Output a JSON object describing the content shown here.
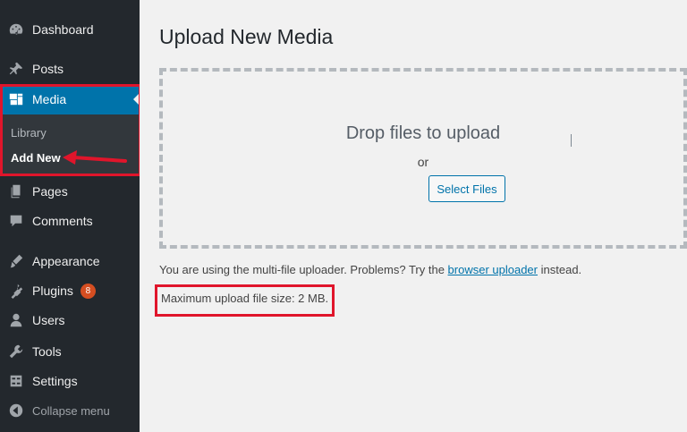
{
  "sidebar": {
    "items": [
      {
        "label": "Dashboard",
        "icon": "dashboard-icon"
      },
      {
        "label": "Posts",
        "icon": "pin-icon"
      },
      {
        "label": "Media",
        "icon": "media-icon"
      },
      {
        "label": "Pages",
        "icon": "pages-icon"
      },
      {
        "label": "Comments",
        "icon": "comments-icon"
      },
      {
        "label": "Appearance",
        "icon": "appearance-icon"
      },
      {
        "label": "Plugins",
        "icon": "plugins-icon",
        "badge": "8"
      },
      {
        "label": "Users",
        "icon": "users-icon"
      },
      {
        "label": "Tools",
        "icon": "tools-icon"
      },
      {
        "label": "Settings",
        "icon": "settings-icon"
      }
    ],
    "submenu": {
      "library": "Library",
      "add_new": "Add New"
    },
    "collapse_label": "Collapse menu"
  },
  "main": {
    "title": "Upload New Media",
    "drop_text": "Drop files to upload",
    "or_text": "or",
    "select_files_label": "Select Files",
    "uploader_note_before": "You are using the multi-file uploader. Problems? Try the",
    "uploader_link": "browser uploader",
    "uploader_note_after": "instead.",
    "max_size": "Maximum upload file size: 2 MB."
  },
  "colors": {
    "sidebar_bg": "#23282d",
    "accent": "#0073aa",
    "badge": "#d54e21",
    "annotation": "#e0152b"
  }
}
